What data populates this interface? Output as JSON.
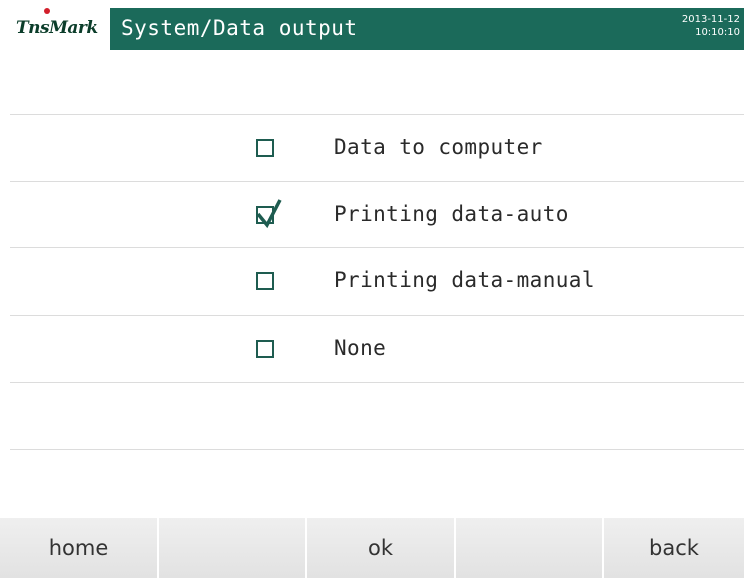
{
  "header": {
    "logo_text": "TnsMark",
    "title": "System/Data output",
    "date": "2013-11-12",
    "time": "10:10:10"
  },
  "options": [
    {
      "label": "Data to computer",
      "checked": false
    },
    {
      "label": "Printing data-auto",
      "checked": true
    },
    {
      "label": "Printing data-manual",
      "checked": false
    },
    {
      "label": "None",
      "checked": false
    }
  ],
  "toolbar": {
    "home_label": "home",
    "blank1_label": "",
    "ok_label": "ok",
    "blank2_label": "",
    "back_label": "back"
  },
  "colors": {
    "title_bar": "#1b6a5a",
    "checkbox_border": "#1e5c50",
    "logo_dot": "#d21f2b"
  },
  "icons": {
    "checkmark": "check-icon",
    "logo": "logo-icon"
  }
}
